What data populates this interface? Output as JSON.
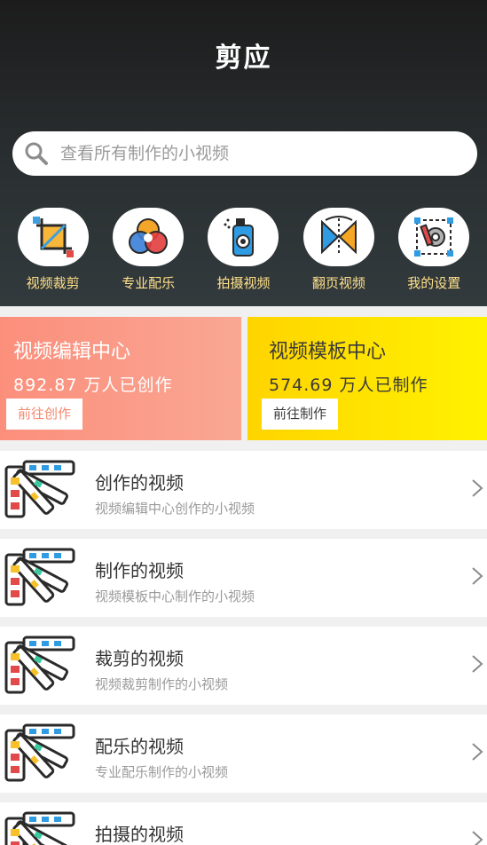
{
  "app": {
    "title": "剪应"
  },
  "search": {
    "placeholder": "查看所有制作的小视频"
  },
  "quick_actions": [
    {
      "label": "视频裁剪",
      "icon": "crop-icon"
    },
    {
      "label": "专业配乐",
      "icon": "color-circles-icon"
    },
    {
      "label": "拍摄视频",
      "icon": "camera-spray-icon"
    },
    {
      "label": "翻页视频",
      "icon": "page-flip-icon"
    },
    {
      "label": "我的设置",
      "icon": "settings-icon"
    }
  ],
  "cards": [
    {
      "title": "视频编辑中心",
      "count": "892.87 万人已创作",
      "button": "前往创作",
      "color": "#fb8f7c"
    },
    {
      "title": "视频模板中心",
      "count": "574.69 万人已制作",
      "button": "前往制作",
      "color": "#ffd400"
    }
  ],
  "video_list": [
    {
      "title": "创作的视频",
      "subtitle": "视频编辑中心创作的小视频",
      "icon": "color-swatch-icon"
    },
    {
      "title": "制作的视频",
      "subtitle": "视频模板中心制作的小视频",
      "icon": "color-swatch-icon"
    },
    {
      "title": "裁剪的视频",
      "subtitle": "视频裁剪制作的小视频",
      "icon": "color-swatch-icon"
    },
    {
      "title": "配乐的视频",
      "subtitle": "专业配乐制作的小视频",
      "icon": "color-swatch-icon"
    },
    {
      "title": "拍摄的视频",
      "subtitle": "",
      "icon": "color-swatch-icon"
    }
  ]
}
